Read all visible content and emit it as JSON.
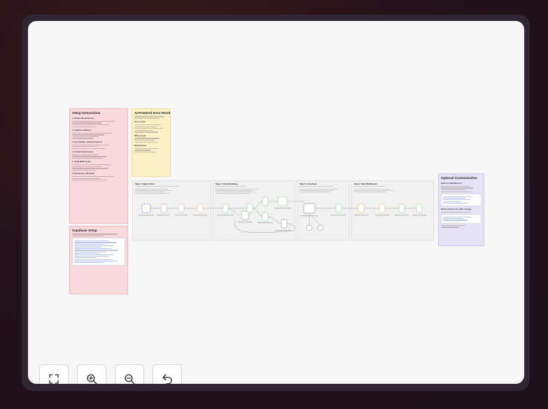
{
  "notes": {
    "setup": {
      "title": "Setup Instructions",
      "headings": [
        "1. Enable n8n API Access",
        "2. Supabase Database",
        "3. Send Notifier / Claude Sonnet AI",
        "4. Content Outlet Access",
        "5. Gmail SMTP server",
        "6. Activate Error Workflow"
      ]
    },
    "supabase": {
      "title": "Supabase Setup"
    },
    "monitor": {
      "title": "AI-Powered Error Monitor",
      "headings": [
        "How it works",
        "What you get",
        "Requirements"
      ]
    },
    "optional": {
      "title": "Optional Customization",
      "headings": [
        "Switch to Slack/Discord",
        "Reduce Token Cost (~50% savings)"
      ]
    }
  },
  "steps": [
    {
      "title": "Step 1: Capture Error"
    },
    {
      "title": "Step 2: Check Database"
    },
    {
      "title": "Step 3: AI Analysis"
    },
    {
      "title": "Step 4: Send Notification"
    }
  ],
  "controls": {
    "fit": "fit-view",
    "zoom_in": "zoom-in",
    "zoom_out": "zoom-out",
    "reset": "reset-view"
  }
}
